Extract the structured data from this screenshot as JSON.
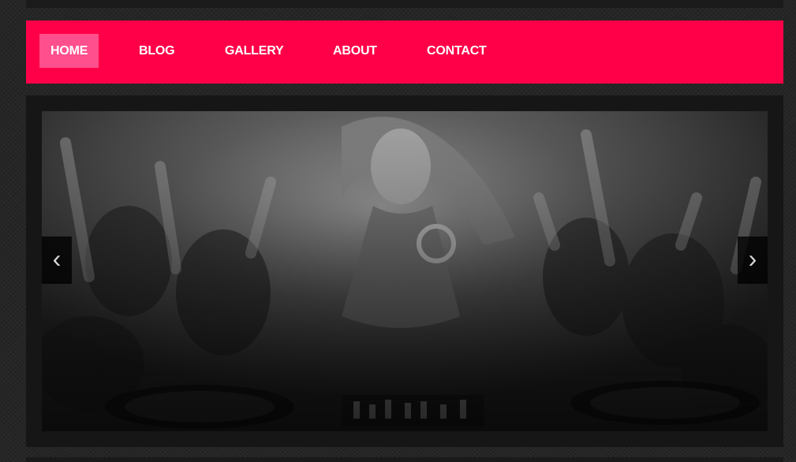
{
  "nav": {
    "items": [
      {
        "label": "HOME",
        "active": true
      },
      {
        "label": "BLOG",
        "active": false
      },
      {
        "label": "GALLERY",
        "active": false
      },
      {
        "label": "ABOUT",
        "active": false
      },
      {
        "label": "CONTACT",
        "active": false
      }
    ],
    "bar_color": "#ff0048",
    "active_color": "#ff4f8c"
  },
  "slider": {
    "prev_glyph": "‹",
    "next_glyph": "›",
    "prev_icon": "chevron-left-icon",
    "next_icon": "chevron-right-icon",
    "image": "grayscale-party-crowd-dj-photo"
  }
}
